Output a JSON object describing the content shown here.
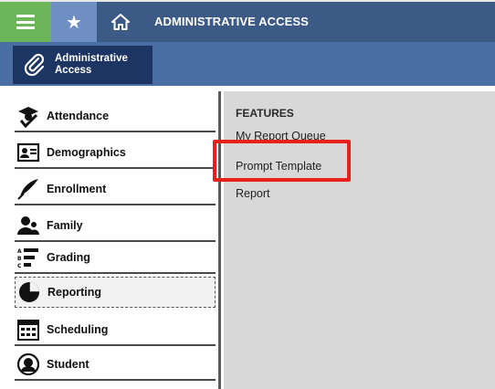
{
  "topbar": {
    "title": "ADMINISTRATIVE ACCESS",
    "menu_icon": "hamburger-icon",
    "favorite_icon": "star-icon",
    "home_icon": "home-icon"
  },
  "module": {
    "label_line1": "Administrative",
    "label_line2": "Access",
    "icon": "paperclip-icon"
  },
  "sidebar": {
    "items": [
      {
        "label": "Attendance",
        "icon": "attendance-icon"
      },
      {
        "label": "Demographics",
        "icon": "id-card-icon"
      },
      {
        "label": "Enrollment",
        "icon": "quill-pen-icon"
      },
      {
        "label": "Family",
        "icon": "family-icon"
      },
      {
        "label": "Grading",
        "icon": "grading-list-icon"
      },
      {
        "label": "Reporting",
        "icon": "pie-chart-icon"
      },
      {
        "label": "Scheduling",
        "icon": "calendar-icon"
      },
      {
        "label": "Student",
        "icon": "student-icon"
      }
    ],
    "active": "Reporting"
  },
  "content": {
    "heading": "FEATURES",
    "links": [
      "My Report Queue",
      "Prompt Template",
      "Report"
    ],
    "highlighted": "Prompt Template"
  },
  "colors": {
    "topbar": "#3b5a86",
    "menu_button": "#6cb558",
    "star_button": "#6f8ec2",
    "secondary_bar": "#4a6fa5",
    "module_tab": "#1c3563",
    "content_bg": "#d8d8d8",
    "highlight": "#e8201a"
  }
}
